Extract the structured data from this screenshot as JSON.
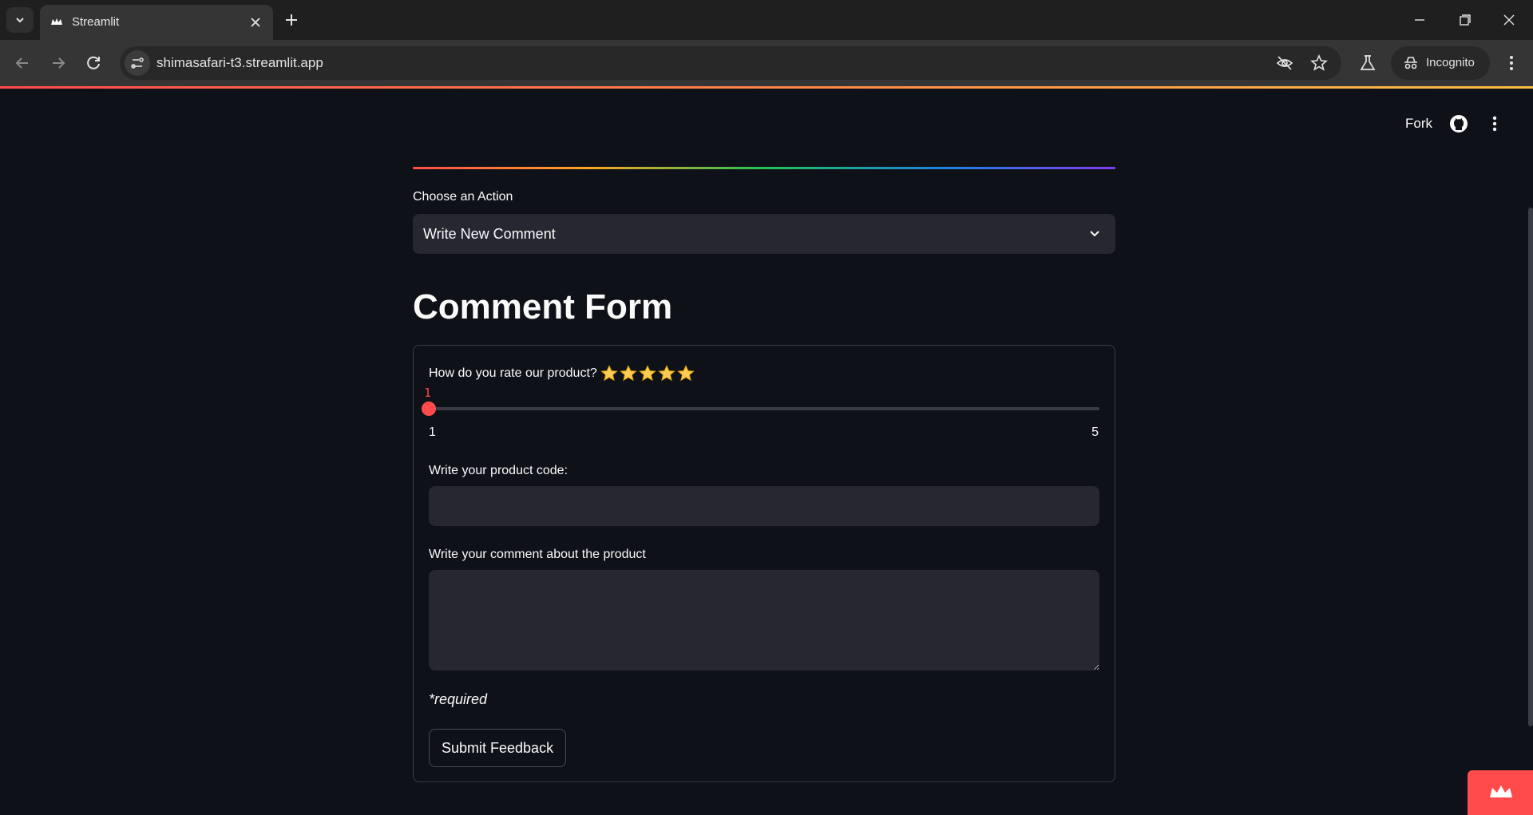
{
  "browser": {
    "tab_title": "Streamlit",
    "url": "shimasafari-t3.streamlit.app",
    "incognito_label": "Incognito"
  },
  "header": {
    "fork_label": "Fork"
  },
  "action_select": {
    "label": "Choose an Action",
    "value": "Write New Comment"
  },
  "page_title": "Comment Form",
  "form": {
    "rating_label": "How do you rate our product?",
    "rating_stars": 5,
    "rating_value": "1",
    "rating_value_number": 1,
    "rating_min": "1",
    "rating_max": "5",
    "product_code_label": "Write your product code:",
    "product_code_value": "",
    "comment_label": "Write your comment about the product",
    "comment_value": "",
    "required_note": "*required",
    "submit_label": "Submit Feedback"
  },
  "colors": {
    "accent": "#ff4b4b",
    "background": "#0e1117",
    "input_bg": "#262730",
    "star": "#fdcb58"
  },
  "icons": [
    "tab-list-icon",
    "streamlit-logo-icon",
    "close-icon",
    "plus-icon",
    "minimize-icon",
    "restore-icon",
    "close-window-icon",
    "back-icon",
    "forward-icon",
    "reload-icon",
    "site-info-icon",
    "eye-off-icon",
    "star-bookmark-icon",
    "labs-icon",
    "incognito-icon",
    "menu-icon",
    "github-icon",
    "chevron-down-icon",
    "star-icon"
  ]
}
